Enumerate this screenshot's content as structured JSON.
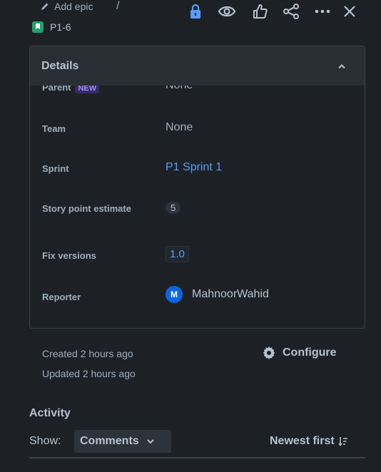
{
  "breadcrumb": {
    "epic_label": "Add epic",
    "separator": "/",
    "issue_key": "P1-6"
  },
  "details": {
    "title": "Details",
    "parent": {
      "label": "Parent",
      "badge": "NEW",
      "value": "None"
    },
    "team": {
      "label": "Team",
      "value": "None"
    },
    "sprint": {
      "label": "Sprint",
      "value": "P1 Sprint 1"
    },
    "story_points": {
      "label": "Story point estimate",
      "value": "5"
    },
    "fix_versions": {
      "label": "Fix versions",
      "value": "1.0"
    },
    "reporter": {
      "label": "Reporter",
      "initial": "M",
      "name": "MahnoorWahid"
    }
  },
  "meta": {
    "created": "Created 2 hours ago",
    "updated": "Updated 2 hours ago",
    "configure_label": "Configure"
  },
  "activity": {
    "title": "Activity",
    "show_label": "Show:",
    "selected_filter": "Comments",
    "sort_label": "Newest first"
  },
  "colors": {
    "background": "#1d2125",
    "link": "#579dff",
    "avatar": "#0c66e4",
    "story_icon": "#22a06b",
    "action_accent": "#579dff"
  }
}
